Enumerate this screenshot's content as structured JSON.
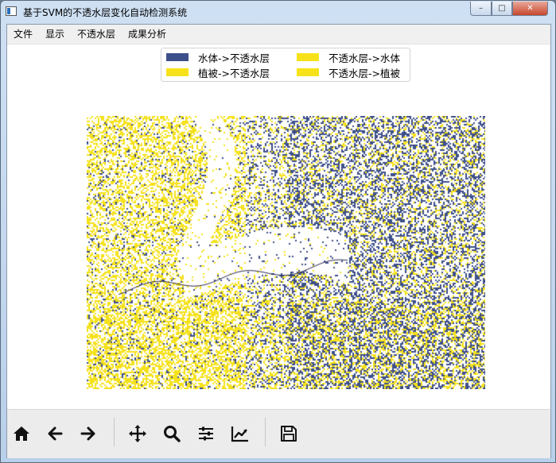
{
  "window": {
    "title": "基于SVM的不透水层变化自动检测系统",
    "controls": {
      "minimize": "–",
      "maximize": "□",
      "close": "✕"
    }
  },
  "menu": [
    "文件",
    "显示",
    "不透水层",
    "成果分析"
  ],
  "legend": [
    {
      "label": "水体->不透水层",
      "color": "#3d4f8a"
    },
    {
      "label": "不透水层->水体",
      "color": "#f7e21a"
    },
    {
      "label": "植被->不透水层",
      "color": "#f7e21a"
    },
    {
      "label": "不透水层->植被",
      "color": "#f7e21a"
    }
  ],
  "map": {
    "colors": {
      "water": "#3d4f8a",
      "veg": "#f5e11c",
      "background": "#ffffff"
    }
  },
  "toolbar": [
    {
      "name": "home-icon"
    },
    {
      "name": "back-icon"
    },
    {
      "name": "forward-icon"
    },
    {
      "name": "pan-icon"
    },
    {
      "name": "zoom-icon"
    },
    {
      "name": "configure-subplots-icon"
    },
    {
      "name": "edit-axis-icon"
    },
    {
      "name": "save-icon"
    }
  ]
}
